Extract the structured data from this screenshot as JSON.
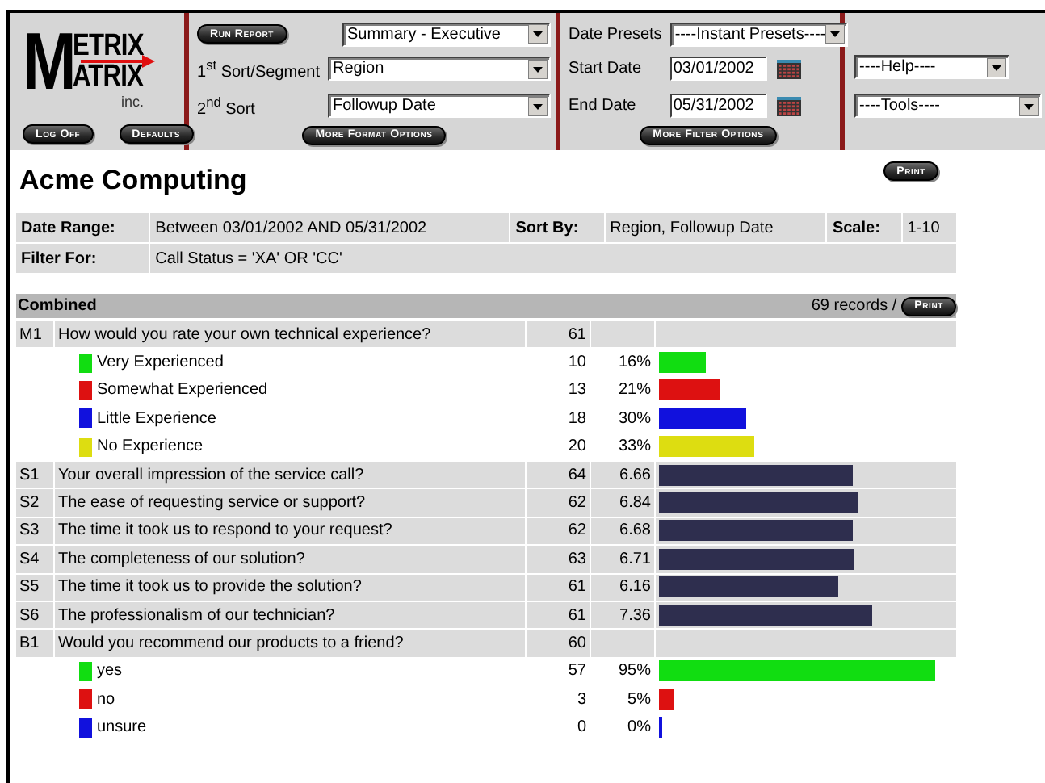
{
  "header": {
    "logo": {
      "initial": "M",
      "line1": "ETRIX",
      "line2": "ATRIX",
      "suffix": "inc."
    },
    "buttons_left": [
      "Log Off",
      "Defaults"
    ],
    "run_report": "Run Report",
    "report_type": "Summary - Executive",
    "sort1": {
      "label": "1$^{st}$ Sort/Segment",
      "value": "Region"
    },
    "sort2": {
      "label": "2$^{nd}$ Sort",
      "value": "Followup Date"
    },
    "more_format": "More Format Options",
    "date_presets": {
      "label": "Date Presets",
      "value": "----Instant Presets----"
    },
    "start_date": {
      "label": "Start Date",
      "value": "03/01/2002"
    },
    "end_date": {
      "label": "End Date",
      "value": "05/31/2002"
    },
    "more_filter": "More Filter Options",
    "help": "----Help----",
    "tools": "----Tools----"
  },
  "report": {
    "title": "Acme Computing",
    "print": "Print",
    "info": [
      {
        "label": "Date Range:",
        "value": "Between 03/01/2002 AND 05/31/2002"
      },
      {
        "label": "Sort By:",
        "value": "Region, Followup Date"
      },
      {
        "label": "Scale:",
        "value": "1-10"
      }
    ],
    "filter": {
      "label": "Filter For:",
      "value": "Call Status = 'XA' OR 'CC'"
    },
    "section": {
      "title": "Combined",
      "records": "69 records /",
      "print": "Print"
    },
    "rows": [
      {
        "kind": "question",
        "code": "M1",
        "text": "How would you rate your own technical experience?",
        "n": "61"
      },
      {
        "kind": "answer",
        "text": "Very Experienced",
        "color": "#11dd11",
        "n": "10",
        "value": "16%",
        "level": 0.16
      },
      {
        "kind": "answer",
        "text": "Somewhat Experienced",
        "color": "#dd1111",
        "n": "13",
        "value": "21%",
        "level": 0.21
      },
      {
        "kind": "answer",
        "text": "Little Experience",
        "color": "#1111dd",
        "n": "18",
        "value": "30%",
        "level": 0.3
      },
      {
        "kind": "answer",
        "text": "No Experience",
        "color": "#dddd11",
        "n": "20",
        "value": "33%",
        "level": 0.33
      },
      {
        "kind": "question",
        "code": "S1",
        "text": "Your overall impression of the service call?",
        "n": "64",
        "value": "6.66",
        "level": 0.666
      },
      {
        "kind": "question",
        "code": "S2",
        "text": "The ease of requesting service or support?",
        "n": "62",
        "value": "6.84",
        "level": 0.684
      },
      {
        "kind": "question",
        "code": "S3",
        "text": "The time it took us to respond to your request?",
        "n": "62",
        "value": "6.68",
        "level": 0.668
      },
      {
        "kind": "question",
        "code": "S4",
        "text": "The completeness of our solution?",
        "n": "63",
        "value": "6.71",
        "level": 0.671
      },
      {
        "kind": "question",
        "code": "S5",
        "text": "The time it took us to provide the solution?",
        "n": "61",
        "value": "6.16",
        "level": 0.616
      },
      {
        "kind": "question",
        "code": "S6",
        "text": "The professionalism of our technician?",
        "n": "61",
        "value": "7.36",
        "level": 0.736
      },
      {
        "kind": "question",
        "code": "B1",
        "text": "Would you recommend our products to a friend?",
        "n": "60"
      },
      {
        "kind": "answer",
        "text": "yes",
        "color": "#11dd11",
        "n": "57",
        "value": "95%",
        "level": 0.95
      },
      {
        "kind": "answer",
        "text": "no",
        "color": "#dd1111",
        "n": "3",
        "value": "5%",
        "level": 0.05
      },
      {
        "kind": "answer",
        "text": "unsure",
        "color": "#1111dd",
        "n": "0",
        "value": "0%",
        "level": 0.0
      }
    ]
  }
}
